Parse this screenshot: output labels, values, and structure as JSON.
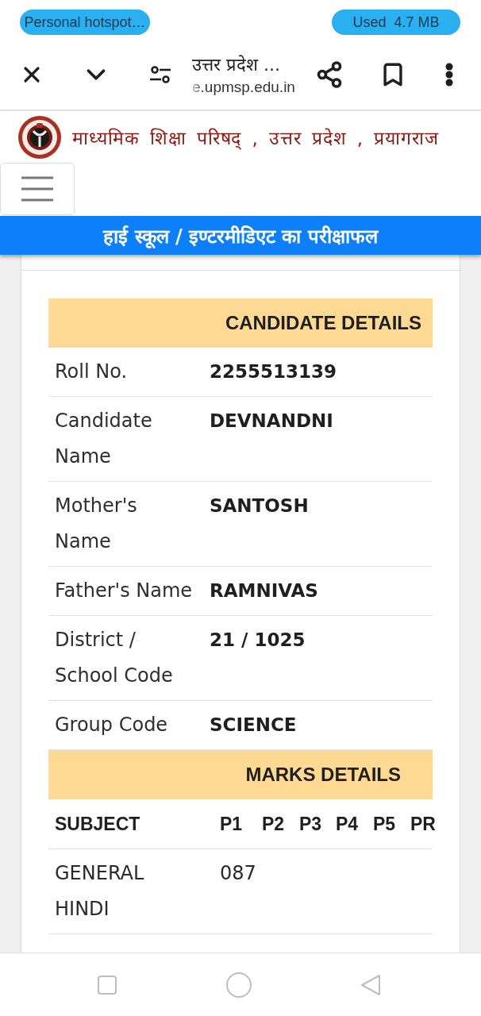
{
  "status_bar": {
    "hotspot": "Personal hotspot…",
    "data_usage": "Used  4.7 MB"
  },
  "browser": {
    "title": "उत्तर प्रदेश ...",
    "url": "e.upmsp.edu.in"
  },
  "site": {
    "title": "माध्यमिक शिक्षा परिषद् , उत्तर प्रदेश , प्रयागराज",
    "banner": "हाई स्कूल / इण्टरमीडिएट का परीक्षाफल"
  },
  "candidate_details": {
    "heading": "CANDIDATE DETAILS",
    "rows": [
      {
        "label": "Roll No.",
        "value": "2255513139"
      },
      {
        "label": "Candidate Name",
        "value": "DEVNANDNI"
      },
      {
        "label": "Mother's Name",
        "value": "SANTOSH"
      },
      {
        "label": "Father's Name",
        "value": "RAMNIVAS"
      },
      {
        "label": "District / School Code",
        "value": "21 / 1025"
      },
      {
        "label": "Group Code",
        "value": "SCIENCE"
      }
    ]
  },
  "marks_details": {
    "heading": "MARKS DETAILS",
    "columns": [
      "SUBJECT",
      "P1",
      "P2",
      "P3",
      "P4",
      "P5",
      "PR"
    ],
    "rows": [
      {
        "subject": "GENERAL HINDI",
        "marks": [
          "087"
        ]
      }
    ]
  }
}
